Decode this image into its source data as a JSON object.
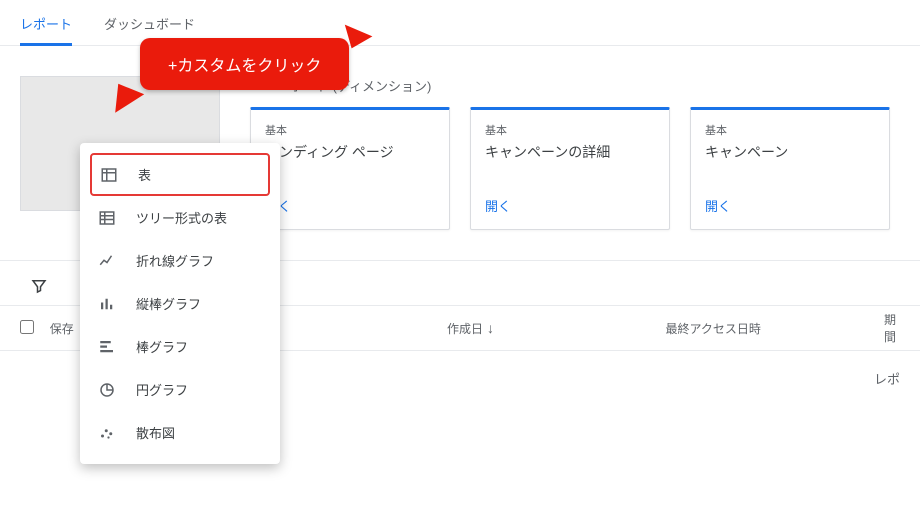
{
  "tabs": {
    "reports": "レポート",
    "dashboards": "ダッシュボード"
  },
  "section_title": "ポート (ディメンション)",
  "cards": [
    {
      "cat": "基本",
      "title": "ランディング ページ",
      "open": "開く"
    },
    {
      "cat": "基本",
      "title": "キャンペーンの詳細",
      "open": "開く"
    },
    {
      "cat": "基本",
      "title": "キャンペーン",
      "open": "開く"
    }
  ],
  "menu": [
    {
      "label": "表"
    },
    {
      "label": "ツリー形式の表"
    },
    {
      "label": "折れ線グラフ"
    },
    {
      "label": "縦棒グラフ"
    },
    {
      "label": "棒グラフ"
    },
    {
      "label": "円グラフ"
    },
    {
      "label": "散布図"
    }
  ],
  "table": {
    "name": "保存",
    "created": "作成日",
    "lastaccess": "最終アクセス日時",
    "period": "期間"
  },
  "empty_text": "レポ",
  "annotation": "+カスタムをクリック"
}
